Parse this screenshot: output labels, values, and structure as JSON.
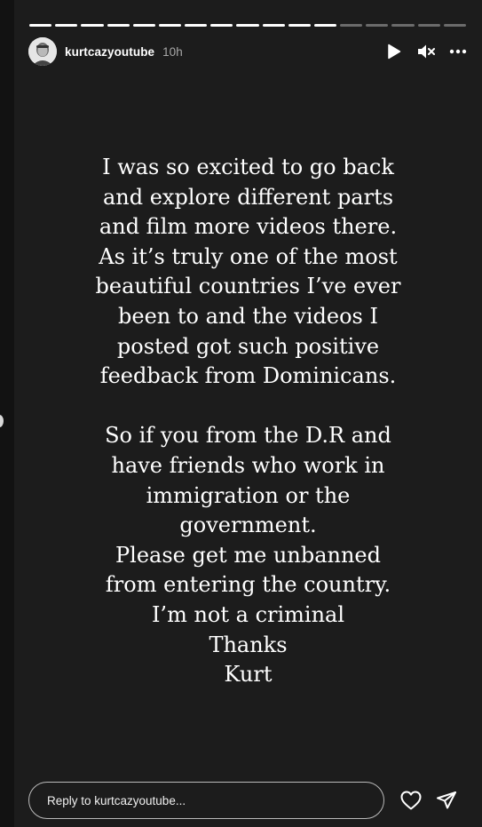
{
  "story": {
    "username": "kurtcazyoutube",
    "time": "10h",
    "progress": {
      "total": 17,
      "completed": 12
    }
  },
  "icons": {
    "avatar": "avatar-icon",
    "play": "play-icon",
    "mute": "volume-muted-icon",
    "more": "more-options-icon",
    "like": "heart-icon",
    "share": "send-icon"
  },
  "text": {
    "paragraph1": [
      "I was so excited to go back",
      "and explore different parts",
      "and film more videos there.",
      "As it’s truly one of the most",
      "beautiful countries I’ve ever",
      "been to and the videos I",
      "posted got such positive",
      "feedback from Dominicans."
    ],
    "paragraph2": [
      "So if you from the D.R and",
      "have friends who work in",
      "immigration or the",
      "government.",
      "Please get me unbanned",
      "from entering the country.",
      "I’m not a criminal",
      "Thanks",
      "Kurt"
    ]
  },
  "reply": {
    "placeholder": "Reply to kurtcazyoutube..."
  },
  "colors": {
    "background": "#1c1c1c",
    "text": "#ffffff",
    "muted": "#a8a8a8"
  }
}
